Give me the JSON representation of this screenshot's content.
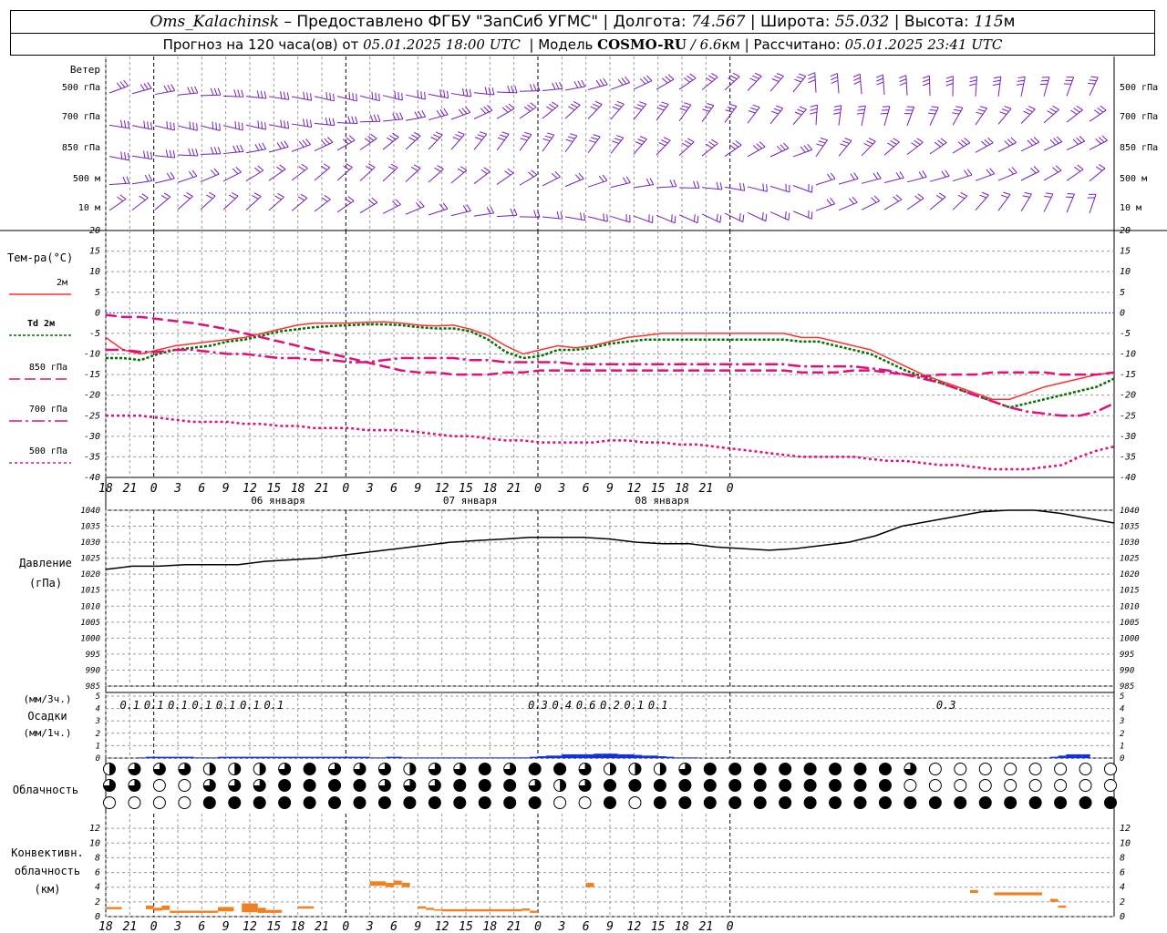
{
  "header": {
    "station": "Oms_Kalachinsk",
    "provider": "– Предоставлено ФГБУ \"ЗапСиб УГМС\"",
    "lon_label": "Долгота:",
    "lon_value": "74.567",
    "lat_label": "Широта:",
    "lat_value": "55.032",
    "alt_label": "Высота:",
    "alt_value": "115",
    "alt_unit": "м",
    "forecast_prefix": "Прогноз на 120 часа(ов) от",
    "forecast_start": "05.01.2025 18:00 UTC",
    "model_label": "Модель",
    "model_name": "COSMO-RU",
    "model_res": "/ 6.6",
    "model_res_unit": "км",
    "calc_label": "Рассчитано:",
    "calc_time": "05.01.2025 23:41 UTC"
  },
  "chart_data": {
    "type": "meteogram",
    "time_ticks": [
      "18",
      "21",
      "0",
      "3",
      "6",
      "9",
      "12",
      "15",
      "18",
      "21",
      "0",
      "3",
      "6",
      "9",
      "12",
      "15",
      "18",
      "21",
      "0",
      "3",
      "6",
      "9",
      "12",
      "15",
      "18",
      "21",
      "0"
    ],
    "date_labels": [
      "06 января",
      "07 января",
      "08 января"
    ],
    "wind": {
      "label": "Ветер",
      "levels": [
        "500 гПа",
        "700 гПа",
        "850 гПа",
        "500 м",
        "10 м"
      ]
    },
    "temperature": {
      "label": "Тем-ра(°С)",
      "ylim": [
        -40,
        20
      ],
      "ticks": [
        20,
        15,
        10,
        5,
        0,
        -5,
        -10,
        -15,
        -20,
        -25,
        -30,
        -35,
        -40
      ],
      "legend": [
        "2м",
        "Td  2м",
        "850 гПа",
        "700 гПа",
        "500 гПа"
      ],
      "colors": [
        "#ff3030",
        "#007000",
        "#e0107a",
        "#e0107a",
        "#e0107a"
      ],
      "series": [
        {
          "name": "2м",
          "values": [
            -6,
            -9,
            -10,
            -9,
            -8,
            -7.5,
            -7,
            -6.5,
            -6,
            -5,
            -4,
            -3,
            -2.5,
            -2.5,
            -2.5,
            -2.3,
            -2.2,
            -2.5,
            -3,
            -3.2,
            -3,
            -4,
            -5.5,
            -8,
            -10,
            -9,
            -8,
            -8.5,
            -8,
            -7,
            -6,
            -5.5,
            -5,
            -5,
            -5,
            -5,
            -5,
            -5,
            -5,
            -5,
            -6,
            -6,
            -7,
            -8,
            -9,
            -11,
            -13,
            -15,
            -16.5,
            -18,
            -19.5,
            -21,
            -21,
            -19.5,
            -18,
            -17,
            -16,
            -15,
            -14.5
          ]
        },
        {
          "name": "Td  2м",
          "values": [
            -11,
            -11,
            -11.5,
            -10,
            -9,
            -8.5,
            -8,
            -7,
            -6.5,
            -5.5,
            -4.5,
            -4,
            -3.5,
            -3.2,
            -3,
            -2.8,
            -2.8,
            -3,
            -3.5,
            -3.8,
            -3.8,
            -4.5,
            -6.5,
            -9.5,
            -11,
            -10.5,
            -9,
            -9,
            -8.5,
            -7.5,
            -7,
            -6.5,
            -6.5,
            -6.5,
            -6.5,
            -6.5,
            -6.5,
            -6.5,
            -6.5,
            -6.5,
            -7,
            -7,
            -8,
            -9,
            -10,
            -12,
            -14,
            -15.5,
            -17,
            -18.5,
            -20,
            -21.5,
            -23,
            -22,
            -21,
            -20,
            -19,
            -18,
            -16
          ]
        },
        {
          "name": "850 гПа",
          "values": [
            -0.5,
            -1,
            -1,
            -1.5,
            -2,
            -2.5,
            -3.2,
            -4,
            -5,
            -6,
            -7,
            -8,
            -9,
            -10,
            -11,
            -12,
            -13,
            -14,
            -14.5,
            -14.5,
            -15,
            -15,
            -15,
            -14.5,
            -14.5,
            -14,
            -14,
            -14,
            -14,
            -14,
            -14,
            -14,
            -14,
            -14,
            -14,
            -14,
            -14,
            -14,
            -14,
            -14,
            -14.5,
            -14.5,
            -14.5,
            -14,
            -14,
            -14.5,
            -15,
            -15.5,
            -15,
            -15,
            -15,
            -14.5,
            -14.5,
            -14.5,
            -14.5,
            -15,
            -15,
            -15,
            -14.5
          ]
        },
        {
          "name": "700 гПа",
          "values": [
            -9,
            -9,
            -9.5,
            -9.5,
            -9,
            -9,
            -9.5,
            -10,
            -10,
            -10.5,
            -11,
            -11,
            -11.5,
            -11.5,
            -12,
            -12,
            -11.5,
            -11,
            -11,
            -11,
            -11,
            -11.5,
            -11.5,
            -12,
            -12,
            -12,
            -12,
            -12.5,
            -12.5,
            -12.5,
            -12.5,
            -12.5,
            -12.5,
            -12.5,
            -12.5,
            -12.5,
            -12.5,
            -12.5,
            -12.5,
            -12.5,
            -13,
            -13,
            -13,
            -13,
            -13.5,
            -14,
            -15,
            -16,
            -17,
            -18.5,
            -20,
            -21.5,
            -23,
            -24,
            -24.5,
            -25,
            -25,
            -24,
            -22
          ]
        },
        {
          "name": "500 гПа",
          "values": [
            -25,
            -25,
            -25,
            -25.5,
            -26,
            -26.5,
            -26.5,
            -26.5,
            -27,
            -27,
            -27.5,
            -27.5,
            -28,
            -28,
            -28,
            -28.5,
            -28.5,
            -28.5,
            -29,
            -29.5,
            -30,
            -30,
            -30.5,
            -31,
            -31,
            -31.5,
            -31.5,
            -31.5,
            -31.5,
            -31,
            -31,
            -31.5,
            -31.5,
            -32,
            -32,
            -32.5,
            -33,
            -33.5,
            -34,
            -34.5,
            -35,
            -35,
            -35,
            -35,
            -35.5,
            -36,
            -36,
            -36.5,
            -37,
            -37,
            -37.5,
            -38,
            -38,
            -38,
            -37.5,
            -37,
            -35,
            -33.5,
            -32.5
          ]
        }
      ]
    },
    "pressure": {
      "label": "Давление",
      "unit": "(гПа)",
      "ylim": [
        985,
        1040
      ],
      "ticks": [
        1040,
        1035,
        1030,
        1025,
        1020,
        1015,
        1010,
        1005,
        1000,
        995,
        990,
        985
      ],
      "values": [
        1021.5,
        1022.5,
        1022.5,
        1023,
        1023,
        1023,
        1024,
        1024.5,
        1025,
        1026,
        1027,
        1028,
        1029,
        1030,
        1030.5,
        1031,
        1031.5,
        1031.5,
        1031.5,
        1031,
        1030,
        1029.5,
        1029.5,
        1028.5,
        1028,
        1027.5,
        1028,
        1029,
        1030,
        1032,
        1035,
        1036.5,
        1038,
        1039.5,
        1040,
        1040,
        1039,
        1037.5,
        1036
      ]
    },
    "precipitation": {
      "label": "Осадки",
      "unit_top": "(мм/3ч.)",
      "unit_bottom": "(мм/1ч.)",
      "ylim": [
        0,
        5
      ],
      "ticks": [
        5,
        4,
        3,
        2,
        1,
        0
      ],
      "labels": [
        "0.1",
        "0.1",
        "0.1",
        "0.1",
        "0.1",
        "0.1",
        "0.1",
        "0.3",
        "0.4",
        "0.6",
        "0.2",
        "0.1",
        "0.1",
        "0.3"
      ],
      "label_hours": [
        3,
        6,
        9,
        12,
        15,
        18,
        21,
        54,
        57,
        60,
        63,
        66,
        69,
        105
      ],
      "bar_hours": [
        5,
        6,
        7,
        8,
        9,
        10,
        11,
        12,
        13,
        14,
        15,
        16,
        17,
        18,
        19,
        20,
        21,
        22,
        23,
        24,
        25,
        26,
        27,
        28,
        29,
        30,
        31,
        32,
        33,
        34,
        35,
        36,
        37,
        38,
        39,
        40,
        41,
        42,
        43,
        44,
        45,
        46,
        47,
        48,
        49,
        50,
        51,
        52,
        53,
        54,
        55,
        56,
        57,
        58,
        59,
        60,
        61,
        62,
        63,
        64,
        65,
        66,
        67,
        68,
        69,
        70,
        71,
        72,
        73,
        74,
        119,
        120,
        121,
        122,
        123
      ],
      "bar_values": [
        0.05,
        0.1,
        0.1,
        0.1,
        0.1,
        0.1,
        0.1,
        0.05,
        0.05,
        0.05,
        0.1,
        0.1,
        0.1,
        0.1,
        0.1,
        0.1,
        0.1,
        0.1,
        0.1,
        0.1,
        0.1,
        0.1,
        0.1,
        0.1,
        0.1,
        0.1,
        0.1,
        0.1,
        0.1,
        0.05,
        0.05,
        0.1,
        0.1,
        0.05,
        0.05,
        0.05,
        0.05,
        0.05,
        0.05,
        0.05,
        0.05,
        0.05,
        0.05,
        0.05,
        0.05,
        0.05,
        0.05,
        0.05,
        0.05,
        0.1,
        0.15,
        0.2,
        0.2,
        0.3,
        0.3,
        0.3,
        0.3,
        0.35,
        0.35,
        0.35,
        0.3,
        0.3,
        0.25,
        0.2,
        0.2,
        0.15,
        0.1,
        0.05,
        0.05,
        0.05,
        0.1,
        0.2,
        0.3,
        0.3,
        0.3
      ]
    },
    "cloudiness": {
      "label": "Облачность",
      "rows": 3,
      "columns": 41,
      "low": [
        0,
        0,
        0,
        0,
        4,
        4,
        4,
        4,
        4,
        4,
        4,
        4,
        4,
        4,
        4,
        4,
        4,
        4,
        0,
        0,
        4,
        0,
        4,
        4,
        4,
        4,
        4,
        4,
        4,
        4,
        4,
        4,
        4,
        4,
        4,
        4,
        4,
        4,
        4,
        4,
        4
      ],
      "mid": [
        3,
        3,
        0,
        0,
        3,
        3,
        3,
        4,
        4,
        4,
        4,
        3,
        3,
        3,
        4,
        4,
        4,
        3,
        2,
        3,
        4,
        4,
        4,
        4,
        4,
        4,
        4,
        4,
        4,
        4,
        4,
        4,
        0,
        0,
        0,
        0,
        0,
        0,
        0,
        0,
        0
      ],
      "high": [
        2,
        3,
        3,
        3,
        2,
        2,
        2,
        3,
        4,
        3,
        3,
        3,
        2,
        3,
        3,
        4,
        3,
        4,
        4,
        3,
        2,
        2,
        2,
        3,
        4,
        4,
        4,
        4,
        4,
        4,
        4,
        4,
        3,
        0,
        0,
        0,
        0,
        0,
        0,
        0,
        0
      ]
    },
    "convective": {
      "label_line1": "Конвективн.",
      "label_line2": "облачность",
      "unit": "(км)",
      "ylim": [
        0,
        13
      ],
      "ticks": [
        12,
        10,
        8,
        6,
        4,
        2,
        0
      ],
      "segments": [
        {
          "h0": 0,
          "h1": 2,
          "bottom": 1.0,
          "top": 1.3
        },
        {
          "h0": 5,
          "h1": 6,
          "bottom": 1.0,
          "top": 1.5
        },
        {
          "h0": 6,
          "h1": 7,
          "bottom": 0.8,
          "top": 1.2
        },
        {
          "h0": 7,
          "h1": 8,
          "bottom": 0.9,
          "top": 1.5
        },
        {
          "h0": 8,
          "h1": 14,
          "bottom": 0.5,
          "top": 0.8
        },
        {
          "h0": 14,
          "h1": 16,
          "bottom": 0.7,
          "top": 1.3
        },
        {
          "h0": 17,
          "h1": 19,
          "bottom": 0.6,
          "top": 1.8
        },
        {
          "h0": 19,
          "h1": 20,
          "bottom": 0.5,
          "top": 1.2
        },
        {
          "h0": 20,
          "h1": 22,
          "bottom": 0.5,
          "top": 0.9
        },
        {
          "h0": 24,
          "h1": 26,
          "bottom": 1.1,
          "top": 1.4
        },
        {
          "h0": 33,
          "h1": 35,
          "bottom": 4.2,
          "top": 4.8
        },
        {
          "h0": 35,
          "h1": 36,
          "bottom": 4.0,
          "top": 4.6
        },
        {
          "h0": 36,
          "h1": 37,
          "bottom": 4.3,
          "top": 4.9
        },
        {
          "h0": 37,
          "h1": 38,
          "bottom": 4.0,
          "top": 4.6
        },
        {
          "h0": 39,
          "h1": 40,
          "bottom": 1.1,
          "top": 1.4
        },
        {
          "h0": 40,
          "h1": 41,
          "bottom": 0.9,
          "top": 1.2
        },
        {
          "h0": 41,
          "h1": 42,
          "bottom": 0.8,
          "top": 1.0
        },
        {
          "h0": 42,
          "h1": 52,
          "bottom": 0.7,
          "top": 1.0
        },
        {
          "h0": 52,
          "h1": 53,
          "bottom": 0.8,
          "top": 1.1
        },
        {
          "h0": 53,
          "h1": 54,
          "bottom": 0.5,
          "top": 0.8
        },
        {
          "h0": 60,
          "h1": 61,
          "bottom": 4.0,
          "top": 4.6
        },
        {
          "h0": 108,
          "h1": 109,
          "bottom": 3.2,
          "top": 3.6
        },
        {
          "h0": 111,
          "h1": 117,
          "bottom": 2.9,
          "top": 3.3
        },
        {
          "h0": 118,
          "h1": 119,
          "bottom": 2.0,
          "top": 2.4
        },
        {
          "h0": 119,
          "h1": 120,
          "bottom": 1.2,
          "top": 1.5
        }
      ]
    }
  },
  "colors": {
    "grid": "#9a9a9a",
    "wind": "#7020c0",
    "t2m": "#ff3030",
    "td2m": "#007000",
    "upper": "#e0107a",
    "pressure": "#000000",
    "precip": "#1030e0",
    "convective": "#f08020",
    "zero_line": "#3040ff"
  }
}
